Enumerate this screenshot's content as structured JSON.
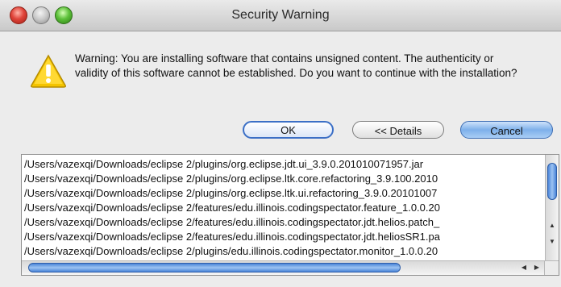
{
  "window": {
    "title": "Security Warning"
  },
  "icons": {
    "warning": "warning-icon"
  },
  "message": {
    "text": "Warning: You are installing software that contains unsigned content. The authenticity or validity of this software cannot be established. Do you want to continue with the installation?"
  },
  "buttons": {
    "ok": "OK",
    "details": "<< Details",
    "cancel": "Cancel"
  },
  "files": [
    "/Users/vazexqi/Downloads/eclipse 2/plugins/org.eclipse.jdt.ui_3.9.0.201010071957.jar",
    "/Users/vazexqi/Downloads/eclipse 2/plugins/org.eclipse.ltk.core.refactoring_3.9.100.2010",
    "/Users/vazexqi/Downloads/eclipse 2/plugins/org.eclipse.ltk.ui.refactoring_3.9.0.20101007",
    "/Users/vazexqi/Downloads/eclipse 2/features/edu.illinois.codingspectator.feature_1.0.0.20",
    "/Users/vazexqi/Downloads/eclipse 2/features/edu.illinois.codingspectator.jdt.helios.patch_",
    "/Users/vazexqi/Downloads/eclipse 2/features/edu.illinois.codingspectator.jdt.heliosSR1.pa",
    "/Users/vazexqi/Downloads/eclipse 2/plugins/edu.illinois.codingspectator.monitor_1.0.0.20"
  ],
  "colors": {
    "accent": "#3b6fc6",
    "warning": "#f2c200"
  }
}
